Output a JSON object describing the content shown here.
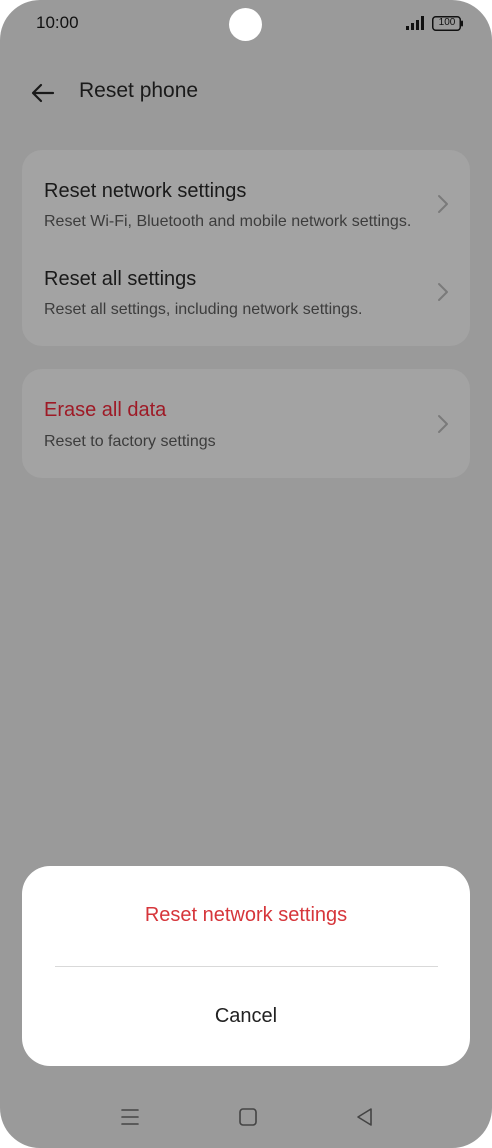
{
  "status": {
    "time": "10:00",
    "battery": "100"
  },
  "appbar": {
    "title": "Reset phone"
  },
  "settings": {
    "items": [
      {
        "title": "Reset network settings",
        "subtitle": "Reset Wi-Fi, Bluetooth and mobile network settings."
      },
      {
        "title": "Reset all settings",
        "subtitle": "Reset all settings, including network settings."
      }
    ],
    "erase": {
      "title": "Erase all data",
      "subtitle": "Reset to factory settings"
    }
  },
  "sheet": {
    "confirm_label": "Reset network settings",
    "cancel_label": "Cancel"
  },
  "colors": {
    "danger": "#9e1a26",
    "confirm": "#d6363b",
    "scrim": "#9a9a9a"
  }
}
